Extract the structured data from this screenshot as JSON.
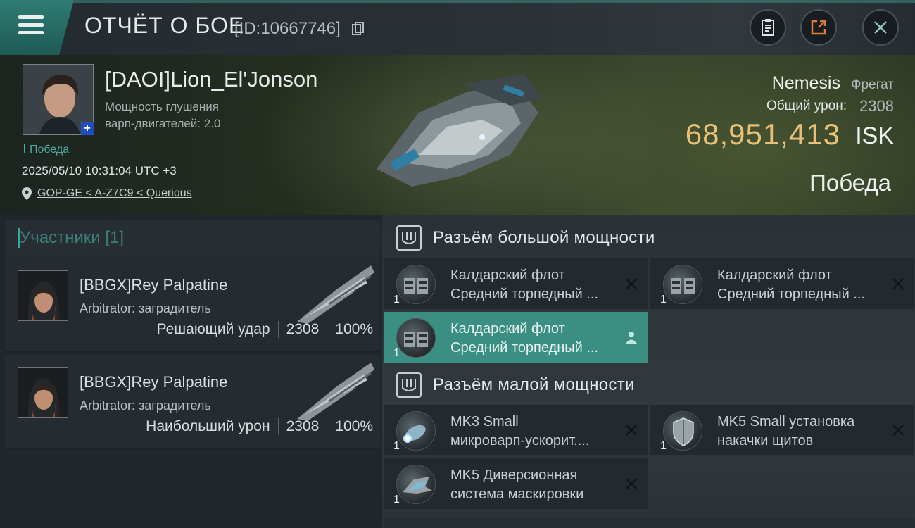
{
  "header": {
    "title": "ОТЧЁТ О БОЕ",
    "battle_id": "[ID:10667746]"
  },
  "victim": {
    "name": "[DAOI]Lion_El'Jonson",
    "warp_label": "Мощность глушения",
    "warp_value": "варп-двигателей: 2.0",
    "result_small": "Победа",
    "datetime": "2025/05/10 10:31:04 UTC +3",
    "location": "GOP-GE < A-Z7C9 < Querious",
    "ship_name": "Nemesis",
    "ship_class": "Фрегат",
    "damage_label": "Общий урон:",
    "damage_value": "2308",
    "isk_value": "68,951,413",
    "isk_unit": "ISK",
    "result_big": "Победа"
  },
  "participants": {
    "title": "Участники [1]",
    "items": [
      {
        "name": "[BBGX]Rey Palpatine",
        "ship": "Arbitrator: заградитель",
        "label": "Решающий удар",
        "damage": "2308",
        "percent": "100%"
      },
      {
        "name": "[BBGX]Rey Palpatine",
        "ship": "Arbitrator: заградитель",
        "label": "Наибольший урон",
        "damage": "2308",
        "percent": "100%"
      }
    ]
  },
  "high_slots": {
    "title": "Разъём большой мощности",
    "items": [
      {
        "line1": "Калдарский флот",
        "line2": "Средний торпедный ...",
        "qty": "1",
        "status": "destroyed"
      },
      {
        "line1": "Калдарский флот",
        "line2": "Средний торпедный ...",
        "qty": "1",
        "status": "destroyed"
      },
      {
        "line1": "Калдарский флот",
        "line2": "Средний торпедный ...",
        "qty": "1",
        "status": "dropped"
      }
    ]
  },
  "low_slots": {
    "title": "Разъём малой мощности",
    "items": [
      {
        "line1": "MK3 Small",
        "line2": "микроварп-ускорит....",
        "qty": "1",
        "status": "destroyed"
      },
      {
        "line1": "MK5 Small установка",
        "line2": "накачки щитов",
        "qty": "1",
        "status": "destroyed"
      },
      {
        "line1": "MK5 Диверсионная",
        "line2": "система маскировки",
        "qty": "1",
        "status": "destroyed"
      }
    ]
  },
  "colors": {
    "accent": "#3a8f82",
    "isk": "#e8c078",
    "teal_text": "#3f7d77"
  },
  "icons": [
    "menu-icon",
    "copy-icon",
    "clipboard-icon",
    "share-icon",
    "close-icon",
    "location-pin-icon",
    "slot-icon",
    "destroyed-x-icon",
    "dropped-person-icon"
  ]
}
